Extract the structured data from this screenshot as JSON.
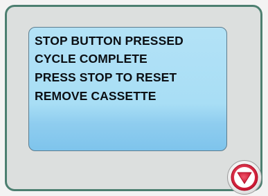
{
  "display": {
    "lines": [
      "STOP BUTTON PRESSED",
      "CYCLE COMPLETE",
      "PRESS STOP TO RESET",
      "REMOVE CASSETTE"
    ]
  },
  "controls": {
    "stop_button_icon": "stop-triangle-icon"
  },
  "colors": {
    "panel_border": "#4c7f70",
    "panel_background": "#dcdfde",
    "screen_background": "#a8def5",
    "stop_accent": "#d6203c"
  }
}
